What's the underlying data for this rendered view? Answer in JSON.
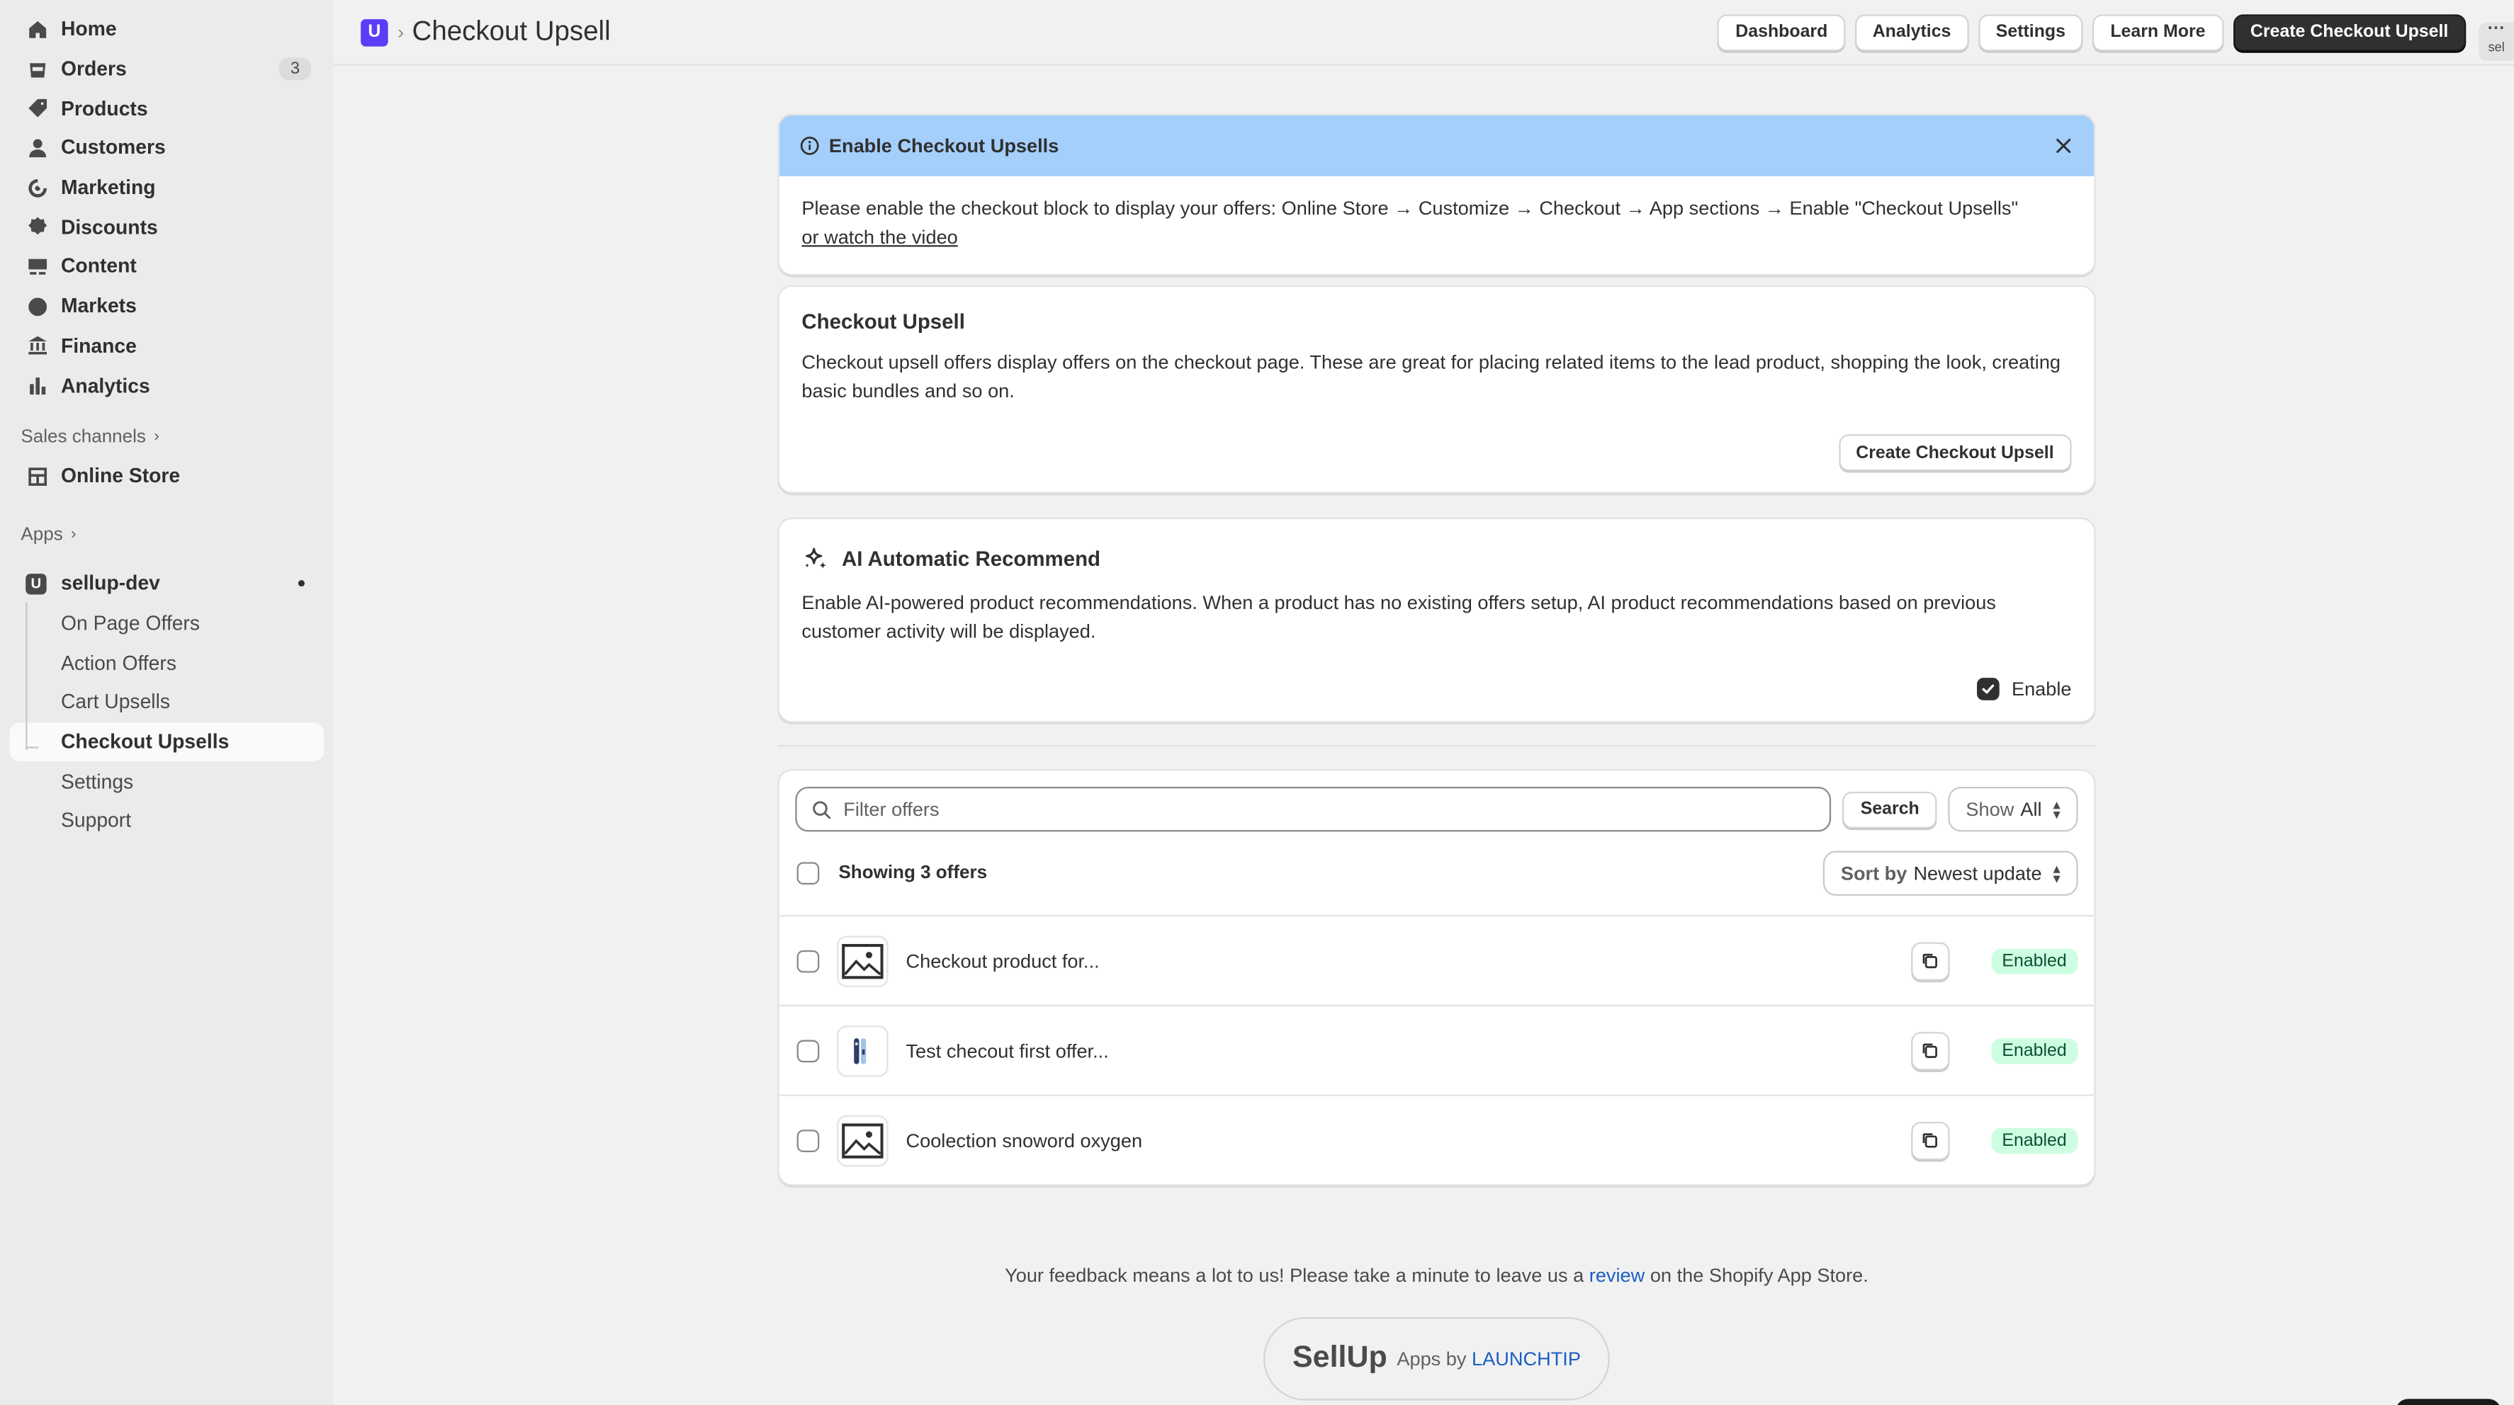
{
  "sidebar": {
    "nav": [
      {
        "label": "Home",
        "icon": "home-icon"
      },
      {
        "label": "Orders",
        "icon": "orders-icon",
        "badge": "3"
      },
      {
        "label": "Products",
        "icon": "tag-icon"
      },
      {
        "label": "Customers",
        "icon": "person-icon"
      },
      {
        "label": "Marketing",
        "icon": "target-icon"
      },
      {
        "label": "Discounts",
        "icon": "discount-icon"
      },
      {
        "label": "Content",
        "icon": "content-icon"
      },
      {
        "label": "Markets",
        "icon": "globe-icon"
      },
      {
        "label": "Finance",
        "icon": "bank-icon"
      },
      {
        "label": "Analytics",
        "icon": "bar-chart-icon"
      }
    ],
    "sales_channels_label": "Sales channels",
    "online_store_label": "Online Store",
    "apps_label": "Apps",
    "app_name": "sellup-dev",
    "app_icon_letter": "U",
    "app_subitems": [
      "On Page Offers",
      "Action Offers",
      "Cart Upsells",
      "Checkout Upsells",
      "Settings",
      "Support"
    ],
    "active_subitem": "Checkout Upsells"
  },
  "header": {
    "logo_letter": "U",
    "breadcrumb_sep": "›",
    "title": "Checkout Upsell",
    "actions": [
      "Dashboard",
      "Analytics",
      "Settings",
      "Learn More"
    ],
    "primary_action": "Create Checkout Upsell",
    "more_dots": "···",
    "more_text": "sel"
  },
  "banner": {
    "title": "Enable Checkout Upsells",
    "body": "Please enable the checkout block to display your offers: Online Store → Customize → Checkout → App sections → Enable \"Checkout Upsells\"",
    "link": "or watch the video",
    "color": "#a4cffb"
  },
  "checkout_card": {
    "title": "Checkout Upsell",
    "text": "Checkout upsell offers display offers on the checkout page. These are great for placing related items to the lead product, shopping the look, creating basic bundles and so on.",
    "button": "Create Checkout Upsell"
  },
  "ai_card": {
    "title": "AI Automatic Recommend",
    "text": "Enable AI-powered product recommendations. When a product has no existing offers setup, AI product recommendations based on previous customer activity will be displayed.",
    "checkbox_label": "Enable",
    "checked": true
  },
  "offers": {
    "search_placeholder": "Filter offers",
    "search_button": "Search",
    "show_prefix": "Show",
    "show_value": "All",
    "count_label": "Showing 3 offers",
    "sort_prefix": "Sort by",
    "sort_value": "Newest update",
    "rows": [
      {
        "title": "Checkout product for...",
        "status": "Enabled",
        "thumb": "image-placeholder-icon"
      },
      {
        "title": "Test checout first offer...",
        "status": "Enabled",
        "thumb": "snowboard-thumbnail"
      },
      {
        "title": "Coolection snoword oxygen",
        "status": "Enabled",
        "thumb": "image-placeholder-icon"
      }
    ]
  },
  "footer": {
    "feedback_before": "Your feedback means a lot to us! Please take a minute to leave us a ",
    "feedback_link": "review",
    "feedback_after": " on the Shopify App Store.",
    "brand": "SellUp",
    "apps_by": "Apps by",
    "company": "LAUNCHTIP"
  }
}
